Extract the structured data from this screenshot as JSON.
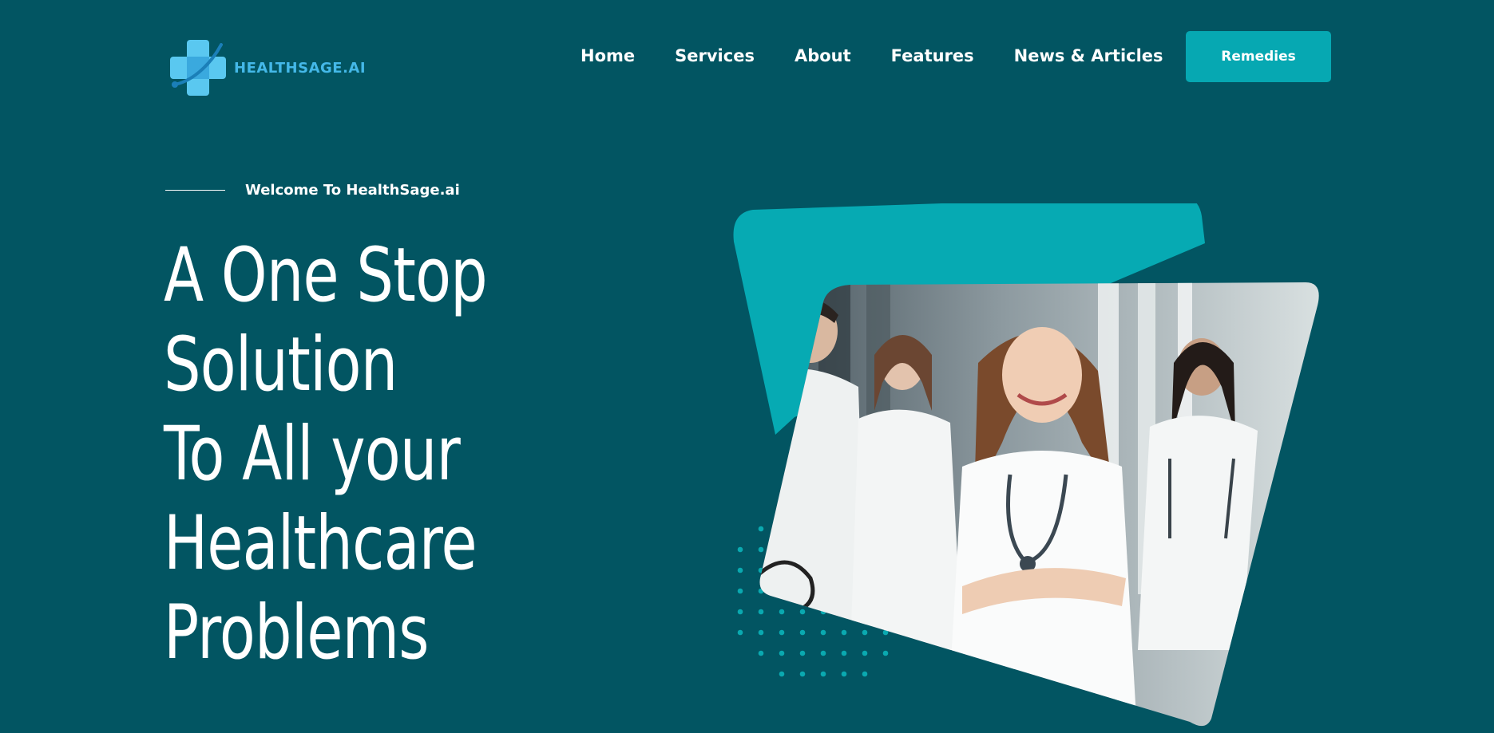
{
  "header": {
    "logo_text": "HEALTHSAGE.AI",
    "logo_icon": "medical-cross-icon",
    "nav": [
      {
        "label": "Home"
      },
      {
        "label": "Services"
      },
      {
        "label": "About"
      },
      {
        "label": "Features"
      },
      {
        "label": "News & Articles"
      }
    ],
    "cta_label": "Remedies"
  },
  "hero": {
    "eyebrow": "Welcome To HealthSage.ai",
    "title_lines": [
      "A One Stop",
      "Solution",
      "To All your",
      "Healthcare",
      "Problems"
    ]
  },
  "colors": {
    "background": "#025562",
    "accent": "#06a8b2",
    "logo_blue": "#44b8e8",
    "text": "#ffffff"
  }
}
